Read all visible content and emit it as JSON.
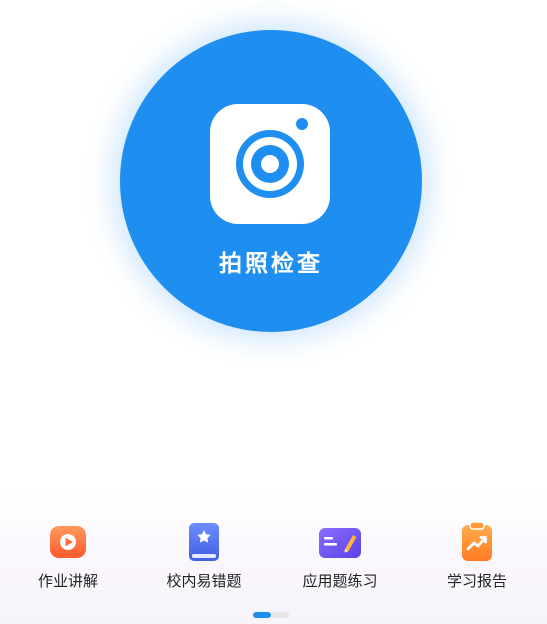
{
  "camera": {
    "label": "拍照检查",
    "icon": "camera-icon",
    "color": "#1e8ef0"
  },
  "features": [
    {
      "label": "作业讲解",
      "icon": "video-play-icon",
      "color": "#ff6b3d"
    },
    {
      "label": "校内易错题",
      "icon": "star-book-icon",
      "color": "#4a70f0"
    },
    {
      "label": "应用题练习",
      "icon": "open-book-pen-icon",
      "color": "#6a54f0"
    },
    {
      "label": "学习报告",
      "icon": "trend-clipboard-icon",
      "color": "#ff8a2d"
    }
  ],
  "pager": {
    "page_count": 2,
    "active_page": 1,
    "active_color": "#1e8ef0"
  }
}
